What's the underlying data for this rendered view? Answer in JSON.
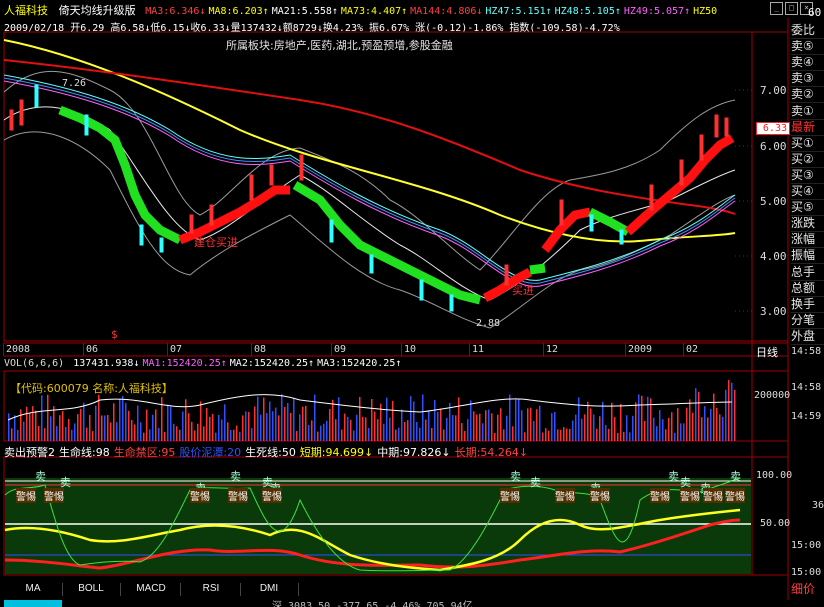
{
  "header": {
    "stock_name": "人福科技",
    "indicator_name": "倚天均线升级版",
    "ma_values": [
      {
        "label": "MA3:6.346↓",
        "color": "#ff4040"
      },
      {
        "label": "MA8:6.203↑",
        "color": "#ffff00"
      },
      {
        "label": "MA21:5.558↑",
        "color": "#ffffff"
      },
      {
        "label": "MA73:4.407↑",
        "color": "#ffff00"
      },
      {
        "label": "MA144:4.806↓",
        "color": "#ff4040"
      },
      {
        "label": "HZ47:5.151↑",
        "color": "#60ffff"
      },
      {
        "label": "HZ48:5.105↑",
        "color": "#60ffff"
      },
      {
        "label": "HZ49:5.057↑",
        "color": "#ff60ff"
      },
      {
        "label": "HZ50",
        "color": "#ffff00"
      }
    ],
    "corner_number": "60",
    "quote_line": "2009/02/18 开6.29 高6.58↓低6.15↓收6.33↓量137432↓额8729↓换4.23% 振6.67% 涨(-0.12)-1.86% 指数(-109.58)-4.72%",
    "sector_line": "所属板块:房地产,医药,湖北,预盈预增,参股金融"
  },
  "main_chart": {
    "price_ticks": [
      "7.00",
      "6.00",
      "5.00",
      "4.00",
      "3.00"
    ],
    "current_price_tag": "6.33",
    "high_label": "7.26",
    "low_label": "2.88",
    "signal_labels": [
      "建仓买进",
      "买进"
    ],
    "dollar_marker": "$",
    "month_labels": [
      "2008",
      "06",
      "07",
      "08",
      "09",
      "10",
      "11",
      "12",
      "2009",
      "02"
    ],
    "period_label": "日线"
  },
  "volume_panel": {
    "title": "VOL(6,6,6)",
    "values": [
      {
        "label": "137431.938↓",
        "color": "#ffffff"
      },
      {
        "label": "MA1:152420.25↑",
        "color": "#ff60ff"
      },
      {
        "label": "MA2:152420.25↑",
        "color": "#ffffff"
      },
      {
        "label": "MA3:152420.25↑",
        "color": "#ffffff"
      }
    ],
    "info_label": "【代码:600079 名称:人福科技】",
    "axis_ticks": [
      "14:58",
      "200000",
      "14:59",
      "14:58"
    ]
  },
  "indicator_panel": {
    "items": [
      {
        "label": "卖出预警2",
        "color": "#ffffff"
      },
      {
        "label": "生命线:98",
        "color": "#ffffff"
      },
      {
        "label": "生命禁区:95",
        "color": "#ff4040"
      },
      {
        "label": "股价泥潭:20",
        "color": "#3050ff"
      },
      {
        "label": "生死线:50",
        "color": "#ffffff"
      },
      {
        "label": "短期:94.699↓",
        "color": "#ffff00"
      },
      {
        "label": "中期:97.826↓",
        "color": "#ffffff"
      },
      {
        "label": "长期:54.264↓",
        "color": "#ff4040"
      }
    ],
    "axis_ticks": [
      "100.00",
      "50.00",
      "15:00",
      "36",
      "15:00"
    ],
    "sell_label": "卖",
    "warn_label": "警惕"
  },
  "bottom_tabs": [
    "MA",
    "BOLL",
    "MACD",
    "RSI",
    "DMI"
  ],
  "status_bar": "深 3083.50 -377.65 -4.46% 705.94亿",
  "right_panel": {
    "items": [
      "委比",
      "卖⑤",
      "卖④",
      "卖③",
      "卖②",
      "卖①",
      "最新",
      "买①",
      "买②",
      "买③",
      "买④",
      "买⑤",
      "涨跌",
      "涨幅",
      "振幅",
      "总手",
      "总额",
      "换手",
      "分笔",
      "外盘"
    ],
    "bottom_label": "细价"
  },
  "window_buttons": [
    "_",
    "□",
    "×"
  ]
}
